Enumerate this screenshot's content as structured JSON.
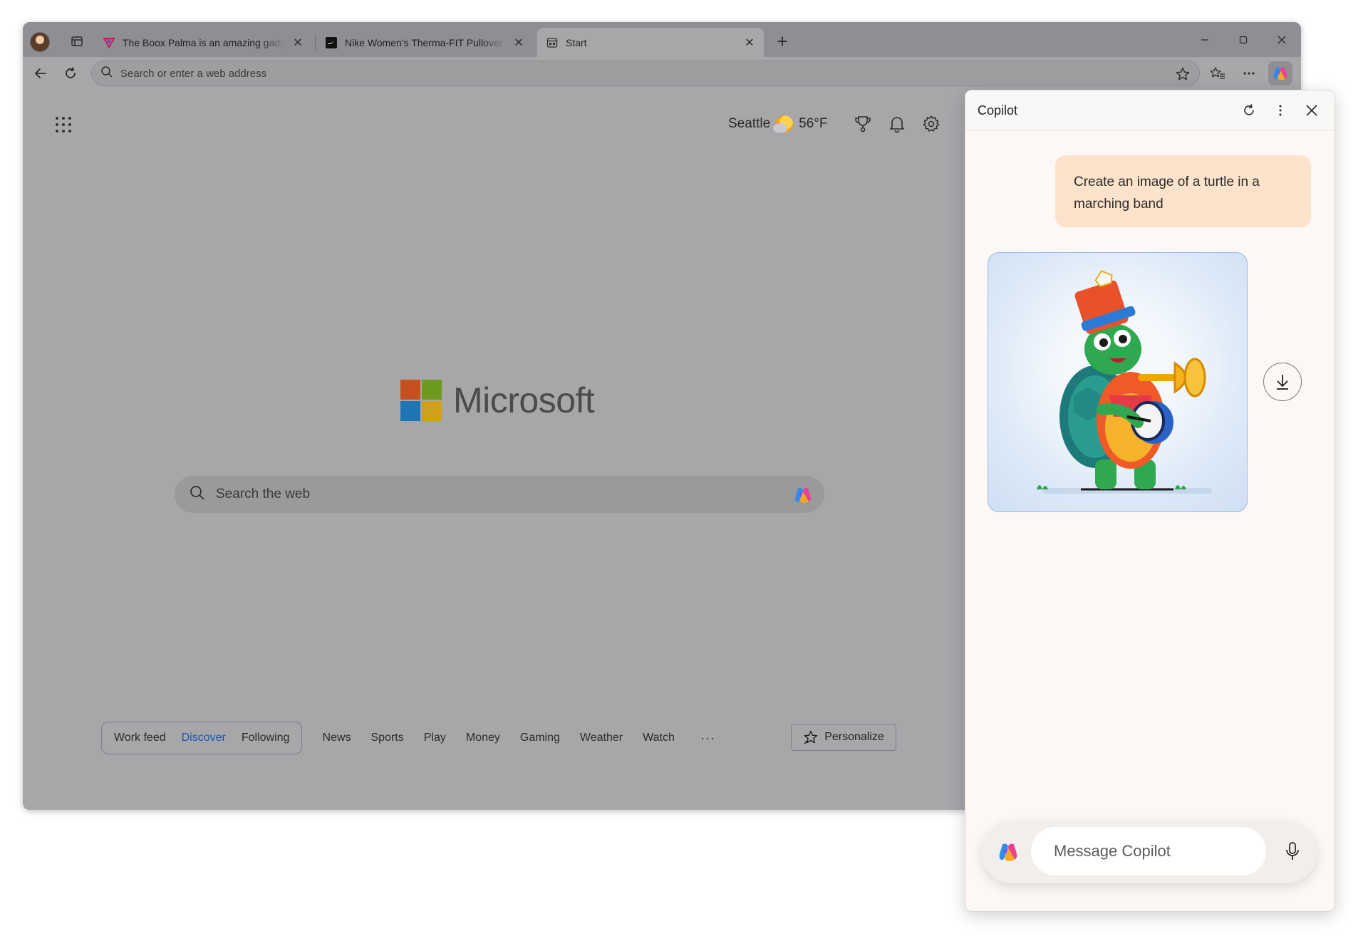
{
  "browser": {
    "tabs": [
      {
        "title": "The Boox Palma is an amazing gadget",
        "favicon": "verge-v-icon"
      },
      {
        "title": "Nike Women's Therma-FIT Pullover",
        "favicon": "nike-icon"
      },
      {
        "title": "Start",
        "favicon": "start-page-icon",
        "active": true
      }
    ],
    "address_placeholder": "Search or enter a web address"
  },
  "page": {
    "weather_city": "Seattle",
    "weather_temp": "56°F",
    "logo_text": "Microsoft",
    "search_placeholder": "Search the web",
    "feed_tabs": [
      "Work feed",
      "Discover",
      "Following"
    ],
    "active_feed": "Discover",
    "categories": [
      "News",
      "Sports",
      "Play",
      "Money",
      "Gaming",
      "Weather",
      "Watch"
    ],
    "more_label": "···",
    "personalize_label": "Personalize"
  },
  "copilot": {
    "title": "Copilot",
    "user_message": "Create an image of a turtle in a marching band",
    "image_subject": "turtle in marching band uniform playing trumpet and drum",
    "input_placeholder": "Message Copilot"
  },
  "colors": {
    "accent_link": "#1c55b5",
    "user_bubble": "#fde3cc",
    "pane_bg": "#fdf8f5"
  }
}
